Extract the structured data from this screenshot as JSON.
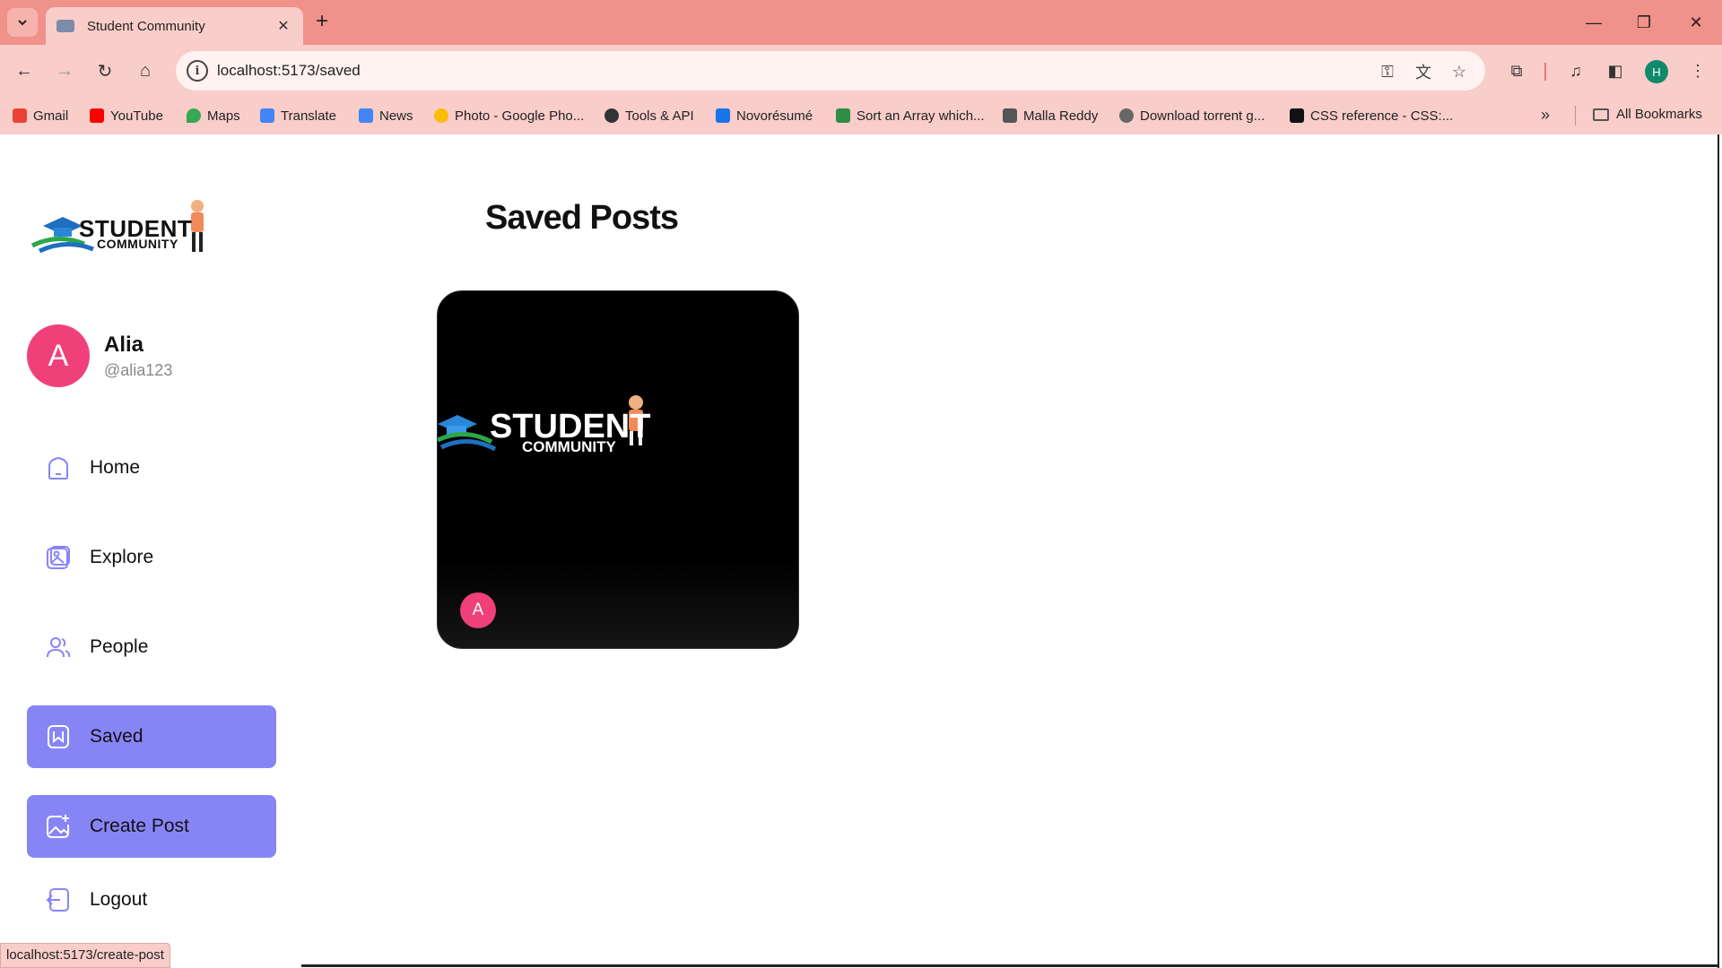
{
  "browser": {
    "tab_title": "Student Community",
    "url": "localhost:5173/saved",
    "profile_initial": "H",
    "bookmarks": [
      {
        "label": "Gmail",
        "color": "#ea4335"
      },
      {
        "label": "YouTube",
        "color": "#ff0000"
      },
      {
        "label": "Maps",
        "color": "#34a853"
      },
      {
        "label": "Translate",
        "color": "#4285f4"
      },
      {
        "label": "News",
        "color": "#4285f4"
      },
      {
        "label": "Photo - Google Pho...",
        "color": "#fbbc05"
      },
      {
        "label": "Tools & API",
        "color": "#333333"
      },
      {
        "label": "Novorésumé",
        "color": "#1a73e8"
      },
      {
        "label": "Sort an Array which...",
        "color": "#2f8d46"
      },
      {
        "label": "Malla Reddy",
        "color": "#555555"
      },
      {
        "label": "Download torrent g...",
        "color": "#666666"
      },
      {
        "label": "CSS reference - CSS:...",
        "color": "#111111"
      }
    ],
    "all_bookmarks": "All Bookmarks",
    "status_url": "localhost:5173/create-post"
  },
  "sidebar": {
    "logo_line1": "STUDENT",
    "logo_line2": "COMMUNITY",
    "user": {
      "initial": "A",
      "name": "Alia",
      "handle": "@alia123"
    },
    "nav": [
      {
        "label": "Home",
        "icon": "home-icon",
        "active": false
      },
      {
        "label": "Explore",
        "icon": "explore-icon",
        "active": false
      },
      {
        "label": "People",
        "icon": "people-icon",
        "active": false
      },
      {
        "label": "Saved",
        "icon": "bookmark-icon",
        "active": true
      },
      {
        "label": "Create Post",
        "icon": "create-post-icon",
        "active": true
      }
    ],
    "logout": "Logout"
  },
  "main": {
    "title": "Saved Posts",
    "posts": [
      {
        "image_text_line1": "STUDENT",
        "image_text_line2": "COMMUNITY",
        "author_initial": "A"
      }
    ]
  },
  "colors": {
    "accent": "#8785f6",
    "avatar": "#f0407a",
    "chrome_tabstrip": "#f0928a",
    "chrome_toolbar": "#f9cdc9"
  }
}
